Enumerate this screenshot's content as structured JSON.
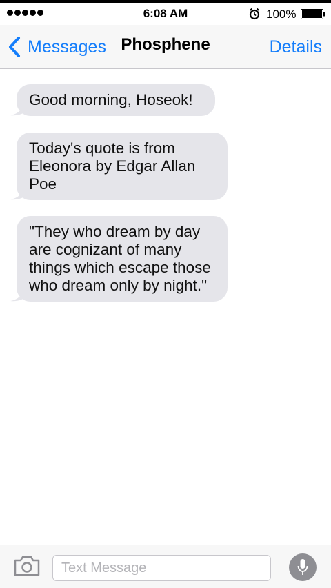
{
  "status_bar": {
    "signal_dots": 5,
    "time": "6:08 AM",
    "alarm_icon": "alarm-clock-icon",
    "battery_percent": "100%",
    "battery_level": 1.0
  },
  "nav": {
    "back_label": "Messages",
    "title": "Phosphene",
    "details_label": "Details",
    "accent_color": "#157efb"
  },
  "messages": [
    {
      "direction": "incoming",
      "text": "Good morning, Hoseok!"
    },
    {
      "direction": "incoming",
      "text": "Today's quote is from Eleonora by Edgar Allan Poe"
    },
    {
      "direction": "incoming",
      "text": "\"They who dream by day are cognizant of many things which escape those who dream only by night.\""
    }
  ],
  "input_bar": {
    "camera_icon": "camera-icon",
    "placeholder": "Text Message",
    "value": "",
    "mic_icon": "microphone-icon"
  },
  "colors": {
    "incoming_bubble": "#e5e5ea",
    "bar_background": "#f7f7f7",
    "mic_button": "#8e8e93"
  }
}
